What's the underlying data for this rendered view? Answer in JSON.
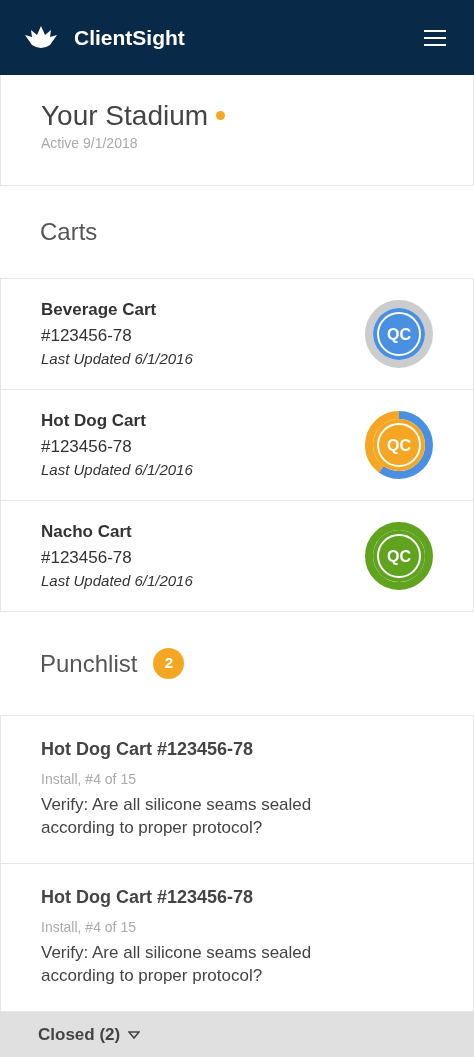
{
  "navbar": {
    "brand": "ClientSight"
  },
  "venue": {
    "title": "Your Stadium",
    "status": {
      "color": "#f5a623"
    },
    "subtitle": "Active 9/1/2018"
  },
  "carts": {
    "heading": "Carts",
    "items": [
      {
        "name": "Beverage Cart",
        "number": "#123456-78",
        "updated": "Last Updated 6/1/2016",
        "badge": "QC",
        "kind": "pending",
        "color": "#4a90e2",
        "ring": [
          {
            "color": "#cccccc"
          }
        ]
      },
      {
        "name": "Hot Dog Cart",
        "number": "#123456-78",
        "updated": "Last Updated 6/1/2016",
        "badge": "QC",
        "kind": "partial",
        "color": "#f5a623",
        "ring": [
          {
            "color": "#4a90e2"
          },
          {
            "color": "#f5a623"
          }
        ]
      },
      {
        "name": "Nacho Cart",
        "number": "#123456-78",
        "updated": "Last Updated 6/1/2016",
        "badge": "QC",
        "kind": "complete",
        "color": "#5fa31f",
        "ring": [
          {
            "color": "#5fa31f"
          }
        ]
      }
    ]
  },
  "punchlist": {
    "heading": "Punchlist",
    "count": "2",
    "items": [
      {
        "title": "Hot Dog Cart #123456-78",
        "meta": "Install, #4 of 15",
        "text": "Verify: Are all silicone seams sealed according to proper protocol?"
      },
      {
        "title": "Hot Dog Cart #123456-78",
        "meta": "Install, #4 of 15",
        "text": "Verify: Are all silicone seams sealed according to proper protocol?"
      }
    ]
  },
  "footer": {
    "label": "Closed (2)",
    "expanded": false
  }
}
